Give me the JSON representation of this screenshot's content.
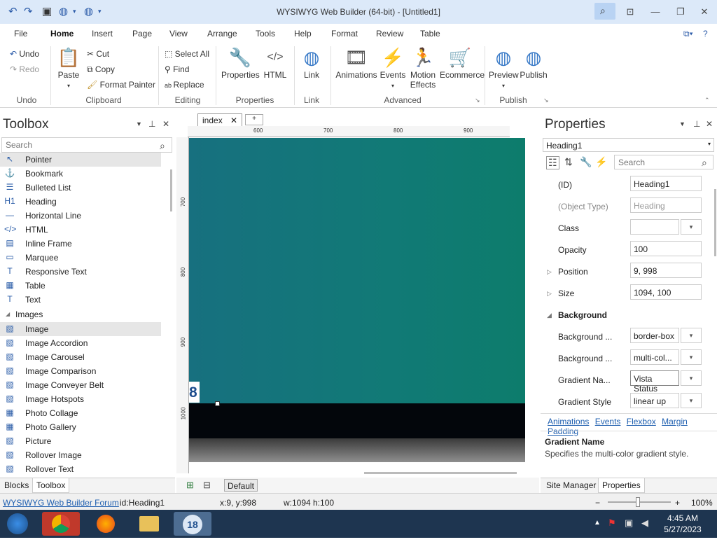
{
  "window": {
    "title": "WYSIWYG Web Builder (64-bit) - [Untitled1]"
  },
  "menu": [
    "File",
    "Home",
    "Insert",
    "Page",
    "View",
    "Arrange",
    "Tools",
    "Help",
    "Format",
    "Review",
    "Table"
  ],
  "ribbon": {
    "undo": "Undo",
    "redo": "Redo",
    "paste": "Paste",
    "cut": "Cut",
    "copy": "Copy",
    "format_painter": "Format Painter",
    "select_all": "Select All",
    "find": "Find",
    "replace": "Replace",
    "properties": "Properties",
    "html": "HTML",
    "link": "Link",
    "animations": "Animations",
    "events": "Events",
    "motion_effects_1": "Motion",
    "motion_effects_2": "Effects",
    "ecommerce": "Ecommerce",
    "preview": "Preview",
    "publish": "Publish",
    "groups": {
      "undo": "Undo",
      "clipboard": "Clipboard",
      "editing": "Editing",
      "properties": "Properties",
      "link": "Link",
      "advanced": "Advanced",
      "publish": "Publish"
    }
  },
  "toolbox": {
    "title": "Toolbox",
    "search_placeholder": "Search",
    "items": [
      {
        "label": "Pointer",
        "icon": "pointer-icon",
        "glyph": "↖"
      },
      {
        "label": "Bookmark",
        "icon": "anchor-icon",
        "glyph": "⚓"
      },
      {
        "label": "Bulleted List",
        "icon": "list-icon",
        "glyph": "☰"
      },
      {
        "label": "Heading",
        "icon": "heading-icon",
        "glyph": "H1"
      },
      {
        "label": "Horizontal Line",
        "icon": "line-icon",
        "glyph": "—"
      },
      {
        "label": "HTML",
        "icon": "code-icon",
        "glyph": "</>"
      },
      {
        "label": "Inline Frame",
        "icon": "frame-icon",
        "glyph": "▤"
      },
      {
        "label": "Marquee",
        "icon": "marquee-icon",
        "glyph": "▭"
      },
      {
        "label": "Responsive Text",
        "icon": "text-icon",
        "glyph": "T"
      },
      {
        "label": "Table",
        "icon": "table-icon",
        "glyph": "▦"
      },
      {
        "label": "Text",
        "icon": "text-icon",
        "glyph": "T"
      }
    ],
    "section_images": "Images",
    "image_items": [
      {
        "label": "Image",
        "icon": "image-icon",
        "glyph": "▧"
      },
      {
        "label": "Image Accordion",
        "icon": "image-icon",
        "glyph": "▧"
      },
      {
        "label": "Image Carousel",
        "icon": "image-icon",
        "glyph": "▧"
      },
      {
        "label": "Image Comparison",
        "icon": "image-icon",
        "glyph": "▧"
      },
      {
        "label": "Image Conveyer Belt",
        "icon": "image-icon",
        "glyph": "▧"
      },
      {
        "label": "Image Hotspots",
        "icon": "image-icon",
        "glyph": "▧"
      },
      {
        "label": "Photo Collage",
        "icon": "collage-icon",
        "glyph": "▦"
      },
      {
        "label": "Photo Gallery",
        "icon": "gallery-icon",
        "glyph": "▦"
      },
      {
        "label": "Picture",
        "icon": "picture-icon",
        "glyph": "▧"
      },
      {
        "label": "Rollover Image",
        "icon": "image-icon",
        "glyph": "▧"
      },
      {
        "label": "Rollover Text",
        "icon": "image-icon",
        "glyph": "▧"
      }
    ],
    "tabs": [
      "Blocks",
      "Toolbox"
    ]
  },
  "editor": {
    "tab": "index",
    "ruler_h": [
      "600",
      "700",
      "800",
      "900"
    ],
    "ruler_v": [
      "700",
      "800",
      "900",
      "1000"
    ],
    "page_digit": "8",
    "default_btn": "Default"
  },
  "properties": {
    "title": "Properties",
    "selected": "Heading1",
    "search_placeholder": "Search",
    "rows": [
      {
        "label": "(ID)",
        "value": "Heading1"
      },
      {
        "label": "(Object Type)",
        "value": "Heading"
      },
      {
        "label": "Class",
        "value": ""
      },
      {
        "label": "Opacity",
        "value": "100"
      },
      {
        "label": "Position",
        "value": "9, 998"
      },
      {
        "label": "Size",
        "value": "1094, 100"
      }
    ],
    "section_background": "Background",
    "bg_rows": [
      {
        "label": "Background ...",
        "value": "border-box"
      },
      {
        "label": "Background ...",
        "value": "multi-col..."
      },
      {
        "label": "Gradient Na...",
        "value": "Vista Status"
      },
      {
        "label": "Gradient Style",
        "value": "linear up"
      }
    ],
    "links": [
      "Animations",
      "Events",
      "Flexbox",
      "Margin",
      "Padding"
    ],
    "help_title": "Gradient Name",
    "help_text": "Specifies the multi-color gradient style.",
    "tabs": [
      "Site Manager",
      "Properties"
    ]
  },
  "status": {
    "forum": "WYSIWYG Web Builder Forum",
    "id": "id:Heading1",
    "xy": "x:9, y:998",
    "wh": "w:1094 h:100",
    "zoom": "100%"
  },
  "taskbar": {
    "time": "4:45 AM",
    "date": "5/27/2023",
    "app_badge": "18"
  }
}
